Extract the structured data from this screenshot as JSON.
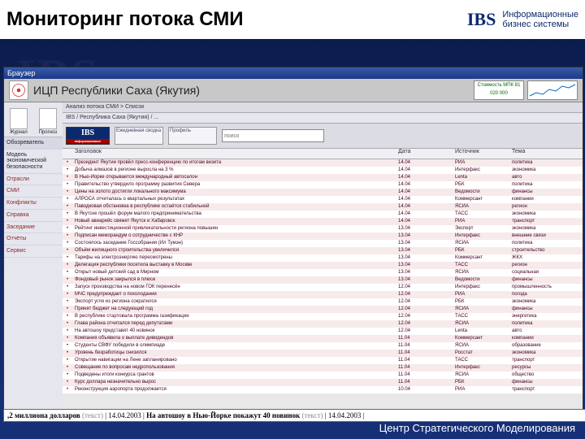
{
  "slide": {
    "title": "Мониторинг потока СМИ",
    "brand_logo": "IBS",
    "brand_line1": "Информационные",
    "brand_line2": "бизнес    системы",
    "watermark": "IBS",
    "footer": "Центр Стратегического Моделирования"
  },
  "window": {
    "titlebar": "Браузер",
    "header_title": "ИЦП Республики Саха (Якутия)",
    "status_box": "Стоимость МПК\n81 020 000",
    "breadcrumb": "Анализ потока СМИ   >  Список",
    "path_line": "IBS  /  Республика Саха (Якутия)  /  ...",
    "search_placeholder": "поиск",
    "toolbar": {
      "block1": "Ежедневная сводка",
      "block2": "Профиль"
    },
    "sidebar": {
      "top_left": "Журнал",
      "top_right": "Прогноз",
      "items": [
        {
          "label": "Обозреватель",
          "kind": "group"
        },
        {
          "label": "Модель экономической безопасности",
          "kind": "dark"
        },
        {
          "label": "Отрасли",
          "kind": "link"
        },
        {
          "label": "СМИ",
          "kind": "link"
        },
        {
          "label": "Конфликты",
          "kind": "link"
        },
        {
          "label": "Справка",
          "kind": "link"
        },
        {
          "label": "Заседание",
          "kind": "link"
        },
        {
          "label": "Отчёты",
          "kind": "link"
        },
        {
          "label": "Сервис",
          "kind": "link"
        }
      ]
    },
    "columns": [
      "",
      "Заголовок",
      "Дата",
      "Источник",
      "Тема"
    ],
    "rows": [
      {
        "t": "Президент Якутии провёл пресс-конференцию по итогам визита",
        "d": "14.04",
        "s": "РИА",
        "g": "политика"
      },
      {
        "t": "Добыча алмазов в регионе выросла на 3 %",
        "d": "14.04",
        "s": "Интерфакс",
        "g": "экономика"
      },
      {
        "t": "В Нью-Йорке открывается международный автосалон",
        "d": "14.04",
        "s": "Lenta",
        "g": "авто"
      },
      {
        "t": "Правительство утвердило программу развития Севера",
        "d": "14.04",
        "s": "РБК",
        "g": "политика"
      },
      {
        "t": "Цены на золото достигли локального максимума",
        "d": "14.04",
        "s": "Ведомости",
        "g": "финансы"
      },
      {
        "t": "АЛРОСА отчиталась о квартальных результатах",
        "d": "14.04",
        "s": "Коммерсант",
        "g": "компании"
      },
      {
        "t": "Паводковая обстановка в республике остаётся стабильной",
        "d": "14.04",
        "s": "ЯСИА",
        "g": "регион"
      },
      {
        "t": "В Якутске прошёл форум малого предпринимательства",
        "d": "14.04",
        "s": "ТАСС",
        "g": "экономика"
      },
      {
        "t": "Новый авиарейс свяжет Якутск и Хабаровск",
        "d": "14.04",
        "s": "РИА",
        "g": "транспорт"
      },
      {
        "t": "Рейтинг инвестиционной привлекательности региона повышен",
        "d": "13.04",
        "s": "Эксперт",
        "g": "экономика"
      },
      {
        "t": "Подписан меморандум о сотрудничестве с КНР",
        "d": "13.04",
        "s": "Интерфакс",
        "g": "внешние связи"
      },
      {
        "t": "Состоялось заседание Госсобрания (Ил Тумэн)",
        "d": "13.04",
        "s": "ЯСИА",
        "g": "политика"
      },
      {
        "t": "Объём жилищного строительства увеличился",
        "d": "13.04",
        "s": "РБК",
        "g": "строительство"
      },
      {
        "t": "Тарифы на электроэнергию пересмотрены",
        "d": "13.04",
        "s": "Коммерсант",
        "g": "ЖКХ"
      },
      {
        "t": "Делегация республики посетила выставку в Москве",
        "d": "13.04",
        "s": "ТАСС",
        "g": "регион"
      },
      {
        "t": "Открыт новый детский сад в Мирном",
        "d": "13.04",
        "s": "ЯСИА",
        "g": "социальная"
      },
      {
        "t": "Фондовый рынок закрылся в плюсе",
        "d": "13.04",
        "s": "Ведомости",
        "g": "финансы"
      },
      {
        "t": "Запуск производства на новом ГОК перенесён",
        "d": "12.04",
        "s": "Интерфакс",
        "g": "промышленность"
      },
      {
        "t": "МЧС предупреждает о похолодании",
        "d": "12.04",
        "s": "РИА",
        "g": "погода"
      },
      {
        "t": "Экспорт угля из региона сократился",
        "d": "12.04",
        "s": "РБК",
        "g": "экономика"
      },
      {
        "t": "Принят бюджет на следующий год",
        "d": "12.04",
        "s": "ЯСИА",
        "g": "финансы"
      },
      {
        "t": "В республике стартовала программа газификации",
        "d": "12.04",
        "s": "ТАСС",
        "g": "энергетика"
      },
      {
        "t": "Глава района отчитался перед депутатами",
        "d": "12.04",
        "s": "ЯСИА",
        "g": "политика"
      },
      {
        "t": "На автошоу представят 40 новинок",
        "d": "12.04",
        "s": "Lenta",
        "g": "авто"
      },
      {
        "t": "Компания объявила о выплате дивидендов",
        "d": "11.04",
        "s": "Коммерсант",
        "g": "компании"
      },
      {
        "t": "Студенты СВФУ победили в олимпиаде",
        "d": "11.04",
        "s": "ЯСИА",
        "g": "образование"
      },
      {
        "t": "Уровень безработицы снизился",
        "d": "11.04",
        "s": "Росстат",
        "g": "экономика"
      },
      {
        "t": "Открытие навигации на Лене запланировано",
        "d": "11.04",
        "s": "ТАСС",
        "g": "транспорт"
      },
      {
        "t": "Совещание по вопросам недропользования",
        "d": "11.04",
        "s": "Интерфакс",
        "g": "ресурсы"
      },
      {
        "t": "Подведены итоги конкурса грантов",
        "d": "11.04",
        "s": "ЯСИА",
        "g": "общество"
      },
      {
        "t": "Курс доллара незначительно вырос",
        "d": "11.04",
        "s": "РБК",
        "g": "финансы"
      },
      {
        "t": "Реконструкция аэропорта продолжается",
        "d": "10.04",
        "s": "РИА",
        "g": "транспорт"
      }
    ]
  },
  "ticker": {
    "part1_bold": ",2 миллиона долларов",
    "part1_grey": " (текст) ",
    "date1": "| 14.04.2003 |",
    "part2_bold": " На автошоу в Нью-Йорке покажут 40 новинок",
    "part2_grey": " (текст) ",
    "date2": "| 14.04.2003 |"
  }
}
